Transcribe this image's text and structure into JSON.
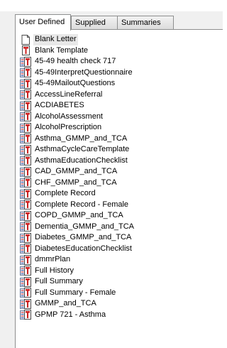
{
  "tabs": [
    {
      "label": "User Defined",
      "active": true
    },
    {
      "label": "Supplied",
      "active": false
    },
    {
      "label": "Summaries",
      "active": false
    }
  ],
  "templates": [
    {
      "label": "Blank Letter",
      "icon": "blank-page-icon",
      "selected": true
    },
    {
      "label": "Blank Template",
      "icon": "template-icon"
    },
    {
      "label": "45-49 health check 717",
      "icon": "form-template-icon"
    },
    {
      "label": "45-49InterpretQuestionnaire",
      "icon": "form-template-icon"
    },
    {
      "label": "45-49MailoutQuestions",
      "icon": "form-template-icon"
    },
    {
      "label": "AccessLineReferral",
      "icon": "form-template-icon"
    },
    {
      "label": "ACDIABETES",
      "icon": "form-template-icon"
    },
    {
      "label": "AlcoholAssessment",
      "icon": "form-template-icon"
    },
    {
      "label": "AlcoholPrescription",
      "icon": "form-template-icon"
    },
    {
      "label": "Asthma_GMMP_and_TCA",
      "icon": "form-template-icon"
    },
    {
      "label": "AsthmaCycleCareTemplate",
      "icon": "form-template-icon"
    },
    {
      "label": "AsthmaEducationChecklist",
      "icon": "form-template-icon"
    },
    {
      "label": "CAD_GMMP_and_TCA",
      "icon": "form-template-icon"
    },
    {
      "label": "CHF_GMMP_and_TCA",
      "icon": "form-template-icon"
    },
    {
      "label": "Complete Record",
      "icon": "form-template-icon"
    },
    {
      "label": "Complete Record - Female",
      "icon": "form-template-icon"
    },
    {
      "label": "COPD_GMMP_and_TCA",
      "icon": "form-template-icon"
    },
    {
      "label": "Dementia_GMMP_and_TCA",
      "icon": "form-template-icon"
    },
    {
      "label": "Diabetes_GMMP_and_TCA",
      "icon": "form-template-icon"
    },
    {
      "label": "DiabetesEducationChecklist",
      "icon": "form-template-icon"
    },
    {
      "label": "dmmrPlan",
      "icon": "form-template-icon"
    },
    {
      "label": "Full History",
      "icon": "form-template-icon"
    },
    {
      "label": "Full Summary",
      "icon": "form-template-icon"
    },
    {
      "label": "Full Summary - Female",
      "icon": "form-template-icon"
    },
    {
      "label": "GMMP_and_TCA",
      "icon": "form-template-icon"
    },
    {
      "label": "GPMP 721 - Asthma",
      "icon": "form-template-icon"
    }
  ],
  "colors": {
    "icon_red": "#cc1f1f",
    "icon_border": "#4a4a4a",
    "selection": "#e8e8e8"
  }
}
